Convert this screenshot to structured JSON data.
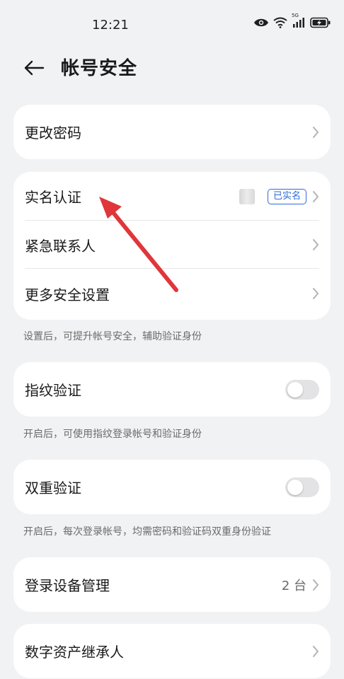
{
  "status_bar": {
    "time": "12:21",
    "icons": [
      "eye-icon",
      "wifi-icon",
      "5g-signal-icon",
      "battery-charging-icon"
    ],
    "network_label": "5G"
  },
  "header": {
    "title": "帐号安全",
    "back_icon": "arrow-left-icon"
  },
  "sections": {
    "change_password": {
      "label": "更改密码"
    },
    "identity": {
      "realname_label": "实名认证",
      "realname_badge": "已实名",
      "emergency_contact_label": "紧急联系人",
      "more_settings_label": "更多安全设置",
      "note": "设置后，可提升帐号安全，辅助验证身份"
    },
    "fingerprint": {
      "label": "指纹验证",
      "enabled": false,
      "note": "开启后，可使用指纹登录帐号和验证身份"
    },
    "two_factor": {
      "label": "双重验证",
      "enabled": false,
      "note": "开启后，每次登录帐号，均需密码和验证码双重身份验证"
    },
    "devices": {
      "label": "登录设备管理",
      "value": "2 台"
    },
    "inheritance": {
      "label": "数字资产继承人"
    }
  },
  "colors": {
    "background": "#f1f2f4",
    "card": "#ffffff",
    "accent_blue": "#2f6ad8",
    "annotation_red": "#e0363b"
  }
}
